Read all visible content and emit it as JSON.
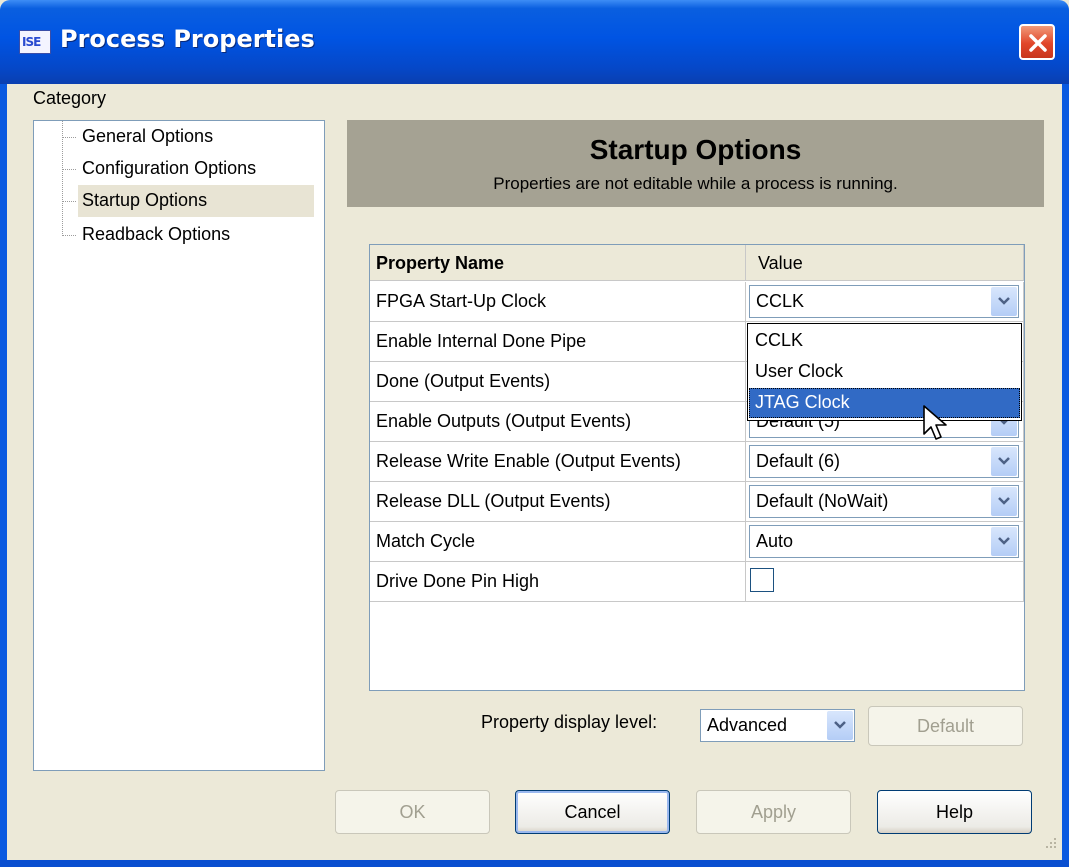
{
  "window": {
    "title": "Process Properties",
    "icon_text": "ISE",
    "close_icon": "close-icon"
  },
  "category": {
    "label": "Category",
    "items": [
      {
        "label": "General Options",
        "selected": false
      },
      {
        "label": "Configuration Options",
        "selected": false
      },
      {
        "label": "Startup Options",
        "selected": true
      },
      {
        "label": "Readback Options",
        "selected": false
      }
    ]
  },
  "header": {
    "title": "Startup Options",
    "subtitle": "Properties are not editable while a process is running."
  },
  "grid": {
    "col_name": "Property Name",
    "col_value": "Value",
    "rows": [
      {
        "name": "FPGA Start-Up Clock",
        "value": "CCLK",
        "type": "combo"
      },
      {
        "name": "Enable Internal Done Pipe",
        "value": "",
        "type": "combo"
      },
      {
        "name": "Done (Output Events)",
        "value": "",
        "type": "combo"
      },
      {
        "name": "Enable Outputs (Output Events)",
        "value": "Default (5)",
        "type": "combo"
      },
      {
        "name": "Release Write Enable (Output Events)",
        "value": "Default (6)",
        "type": "combo"
      },
      {
        "name": "Release DLL (Output Events)",
        "value": "Default (NoWait)",
        "type": "combo"
      },
      {
        "name": "Match Cycle",
        "value": "Auto",
        "type": "combo"
      },
      {
        "name": "Drive Done Pin High",
        "value": false,
        "type": "checkbox"
      }
    ]
  },
  "dropdown": {
    "options": [
      "CCLK",
      "User Clock",
      "JTAG Clock"
    ],
    "highlighted": "JTAG Clock"
  },
  "display_level": {
    "label": "Property display level:",
    "value": "Advanced"
  },
  "buttons": {
    "default": "Default",
    "ok": "OK",
    "cancel": "Cancel",
    "apply": "Apply",
    "help": "Help"
  },
  "colors": {
    "titlebar": "#0054e3",
    "header_panel": "#a5a293",
    "selection": "#316ac5",
    "dialog_bg": "#ece9d8"
  }
}
